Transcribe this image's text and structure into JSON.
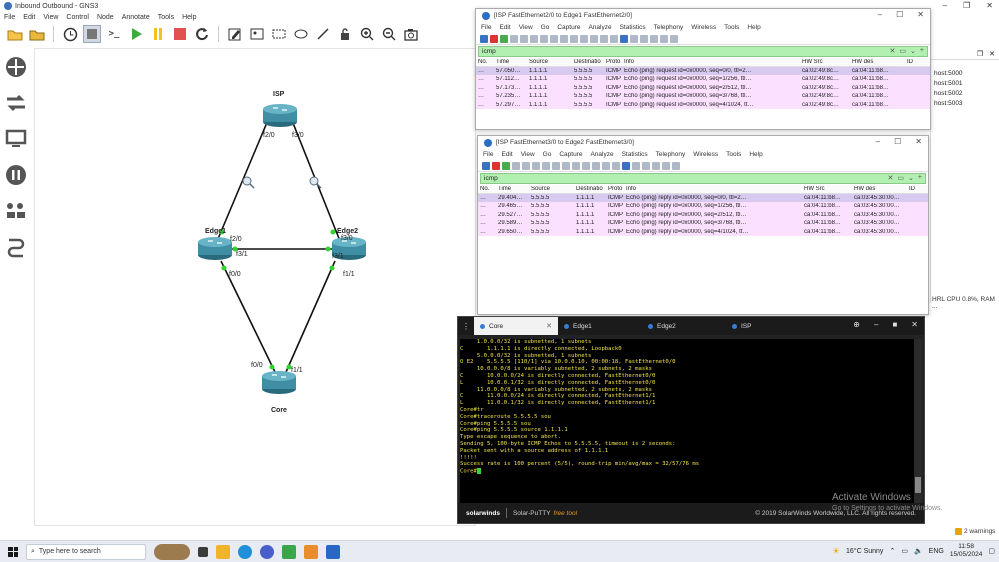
{
  "gns3": {
    "title": "Inbound Outbound - GNS3",
    "menu": [
      "File",
      "Edit",
      "View",
      "Control",
      "Node",
      "Annotate",
      "Tools",
      "Help"
    ],
    "nodes": {
      "isp": "ISP",
      "edge1": "Edge1",
      "edge2": "Edge2",
      "core": "Core"
    },
    "ports": {
      "isp_f20": "f2/0",
      "isp_f30": "f3/0",
      "edge1_f20": "f2/0",
      "edge1_f31": "f3/1",
      "edge1_f00": "f0/0",
      "edge2_f30": "f3/0",
      "edge2_f31": "f3/1",
      "edge2_f11": "f1/1",
      "core_f00": "f0/0",
      "core_f11": "f1/1"
    },
    "right_panel": {
      "rows": [
        "host:5000",
        "host:5001",
        "host:5002",
        "host:5003"
      ],
      "status": "HRL CPU 0.8%, RAM ..."
    },
    "warnings": "2 warnings"
  },
  "ws1": {
    "title": "[ISP FastEthernet2/0 to Edge1 FastEthernet2/0]",
    "menu": [
      "File",
      "Edit",
      "View",
      "Go",
      "Capture",
      "Analyze",
      "Statistics",
      "Telephony",
      "Wireless",
      "Tools",
      "Help"
    ],
    "filter": "icmp",
    "columns": [
      "No.",
      "Time",
      "Source",
      "Destinatio",
      "Proto",
      "Info",
      "HW Src",
      "HW des",
      "ID"
    ],
    "rows": [
      {
        "no": "…",
        "time": "57.050…",
        "src": "1.1.1.1",
        "dst": "5.5.5.5",
        "proto": "ICMP",
        "info": "Echo (ping) request  id=0x0000, seq=0/0, ttl=2…",
        "hws": "ca:02:49:8c…",
        "hwd": "ca:04:11:b8…"
      },
      {
        "no": "…",
        "time": "57.112…",
        "src": "1.1.1.1",
        "dst": "5.5.5.5",
        "proto": "ICMP",
        "info": "Echo (ping) request  id=0x0000, seq=1/256, ttl…",
        "hws": "ca:02:49:8c…",
        "hwd": "ca:04:11:b8…"
      },
      {
        "no": "…",
        "time": "57.173…",
        "src": "1.1.1.1",
        "dst": "5.5.5.5",
        "proto": "ICMP",
        "info": "Echo (ping) request  id=0x0000, seq=2/512, ttl…",
        "hws": "ca:02:49:8c…",
        "hwd": "ca:04:11:b8…"
      },
      {
        "no": "…",
        "time": "57.235…",
        "src": "1.1.1.1",
        "dst": "5.5.5.5",
        "proto": "ICMP",
        "info": "Echo (ping) request  id=0x0000, seq=3/768, ttl…",
        "hws": "ca:02:49:8c…",
        "hwd": "ca:04:11:b8…"
      },
      {
        "no": "…",
        "time": "57.297…",
        "src": "1.1.1.1",
        "dst": "5.5.5.5",
        "proto": "ICMP",
        "info": "Echo (ping) request  id=0x0000, seq=4/1024, tt…",
        "hws": "ca:02:49:8c…",
        "hwd": "ca:04:11:b8…"
      }
    ]
  },
  "ws2": {
    "title": "[ISP FastEthernet3/0 to Edge2 FastEthernet3/0]",
    "menu": [
      "File",
      "Edit",
      "View",
      "Go",
      "Capture",
      "Analyze",
      "Statistics",
      "Telephony",
      "Wireless",
      "Tools",
      "Help"
    ],
    "filter": "icmp",
    "columns": [
      "No.",
      "Time",
      "Source",
      "Destinatio",
      "Proto",
      "Info",
      "HW Src",
      "HW des",
      "ID"
    ],
    "rows": [
      {
        "no": "…",
        "time": "29.404…",
        "src": "5.5.5.5",
        "dst": "1.1.1.1",
        "proto": "ICMP",
        "info": "Echo (ping) reply    id=0x0000, seq=0/0, ttl=2…",
        "hws": "ca:04:11:b8…",
        "hwd": "ca:03:45:30:00…"
      },
      {
        "no": "…",
        "time": "29.465…",
        "src": "5.5.5.5",
        "dst": "1.1.1.1",
        "proto": "ICMP",
        "info": "Echo (ping) reply    id=0x0000, seq=1/256, ttl…",
        "hws": "ca:04:11:b8…",
        "hwd": "ca:03:45:30:00…"
      },
      {
        "no": "…",
        "time": "29.527…",
        "src": "5.5.5.5",
        "dst": "1.1.1.1",
        "proto": "ICMP",
        "info": "Echo (ping) reply    id=0x0000, seq=2/512, ttl…",
        "hws": "ca:04:11:b8…",
        "hwd": "ca:03:45:30:00…"
      },
      {
        "no": "…",
        "time": "29.589…",
        "src": "5.5.5.5",
        "dst": "1.1.1.1",
        "proto": "ICMP",
        "info": "Echo (ping) reply    id=0x0000, seq=3/768, ttl…",
        "hws": "ca:04:11:b8…",
        "hwd": "ca:03:45:30:00…"
      },
      {
        "no": "…",
        "time": "29.650…",
        "src": "5.5.5.5",
        "dst": "1.1.1.1",
        "proto": "ICMP",
        "info": "Echo (ping) reply    id=0x0000, seq=4/1024, tt…",
        "hws": "ca:04:11:b8…",
        "hwd": "ca:03:45:30:00…"
      }
    ]
  },
  "putty": {
    "tabs": [
      "Core",
      "Edge1",
      "Edge2",
      "ISP"
    ],
    "terminal": [
      "     1.0.0.0/32 is subnetted, 1 subnets",
      "C       1.1.1.1 is directly connected, Loopback0",
      "     5.0.0.0/32 is subnetted, 1 subnets",
      "O E2    5.5.5.5 [110/1] via 10.0.0.10, 00:00:18, FastEthernet0/0",
      "     10.0.0.0/8 is variably subnetted, 2 subnets, 2 masks",
      "C       10.0.0.0/24 is directly connected, FastEthernet0/0",
      "L       10.0.0.1/32 is directly connected, FastEthernet0/0",
      "     11.0.0.0/8 is variably subnetted, 2 subnets, 2 masks",
      "C       11.0.0.0/24 is directly connected, FastEthernet1/1",
      "L       11.0.0.1/32 is directly connected, FastEthernet1/1",
      "Core#tr",
      "Core#traceroute 5.5.5.5 sou",
      "Core#ping 5.5.5.5 sou",
      "Core#ping 5.5.5.5 source 1.1.1.1",
      "Type escape sequence to abort.",
      "Sending 5, 100-byte ICMP Echos to 5.5.5.5, timeout is 2 seconds:",
      "Packet sent with a source address of 1.1.1.1",
      "!!!!!",
      "Success rate is 100 percent (5/5), round-trip min/avg/max = 32/57/76 ms",
      "Core#"
    ],
    "footer_brand": "solarwinds",
    "footer_product": "Solar-PuTTY",
    "footer_free": "free tool",
    "footer_copy": "© 2019 SolarWinds Worldwide, LLC. All rights reserved.",
    "activate": "Activate Windows",
    "activate_sub": "Go to Settings to activate Windows."
  },
  "taskbar": {
    "search_placeholder": "Type here to search",
    "weather": "16°C  Sunny",
    "lang": "ENG",
    "time": "11:58",
    "date": "15/05/2024"
  }
}
